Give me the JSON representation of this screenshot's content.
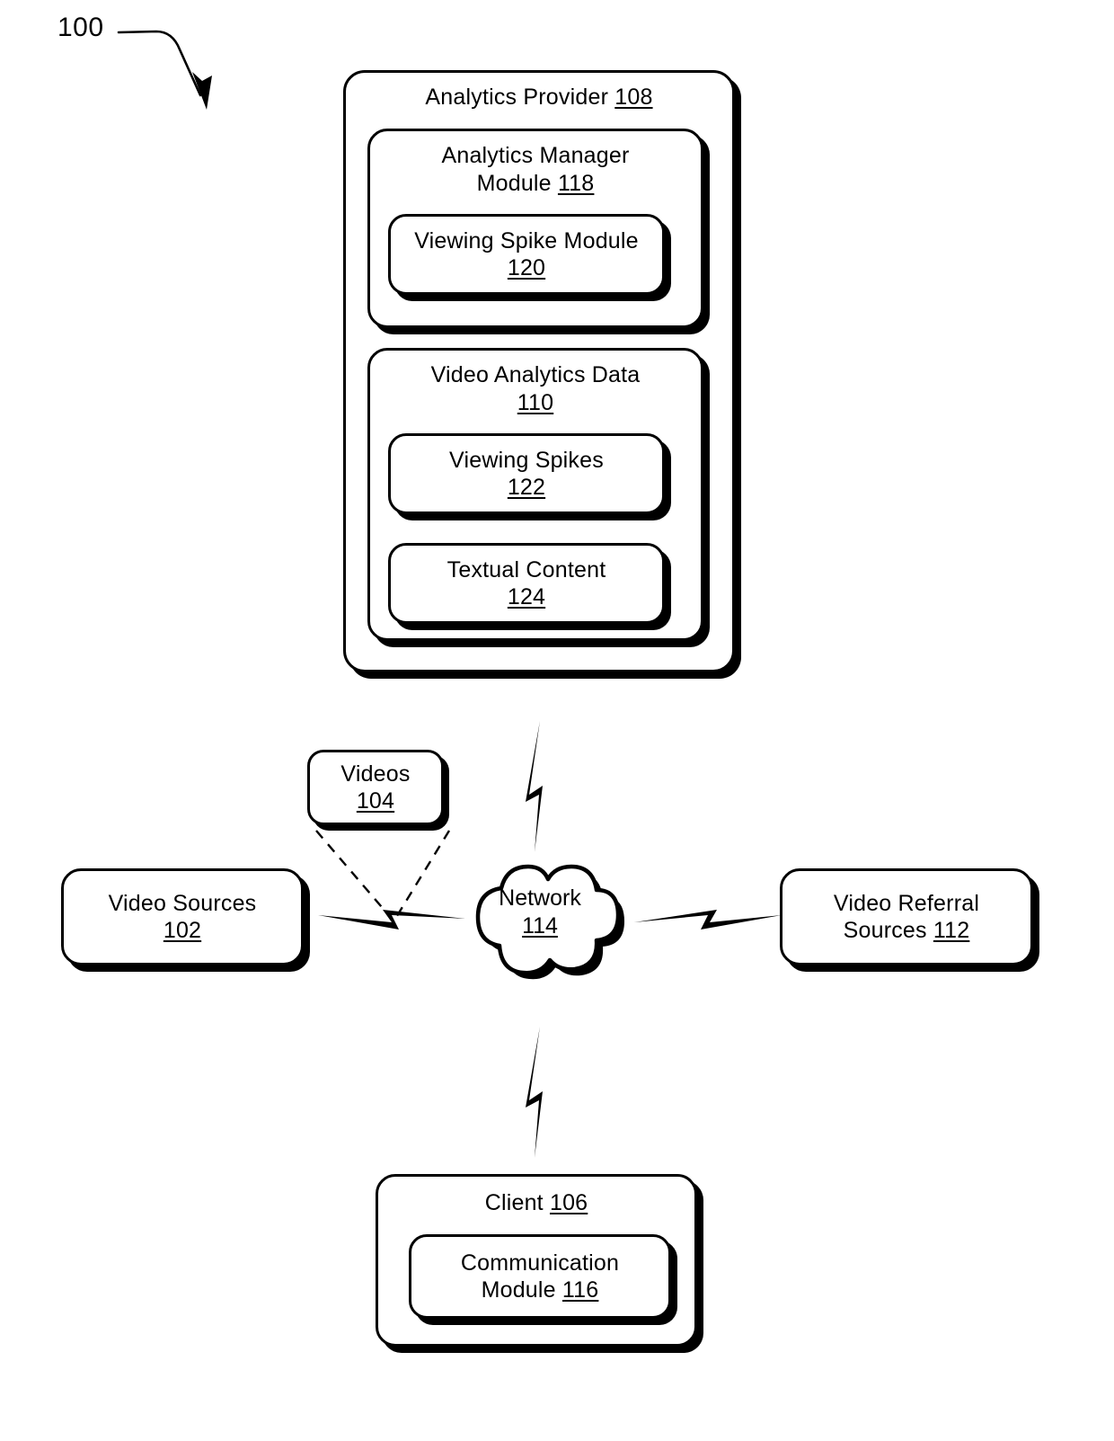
{
  "figure": {
    "number": "100",
    "arrow_icon": "curved-arrow-icon"
  },
  "nodes": {
    "analytics_provider": {
      "label": "Analytics Provider ",
      "ref": "108"
    },
    "analytics_manager_module": {
      "label": "Analytics Manager\nModule ",
      "ref": "118"
    },
    "viewing_spike_module": {
      "label": "Viewing Spike Module\n",
      "ref": "120"
    },
    "video_analytics_data": {
      "label": "Video Analytics Data\n",
      "ref": "110"
    },
    "viewing_spikes": {
      "label": "Viewing Spikes\n",
      "ref": "122"
    },
    "textual_content": {
      "label": "Textual Content\n",
      "ref": "124"
    },
    "videos": {
      "label": "Videos\n",
      "ref": "104"
    },
    "video_sources": {
      "label": "Video Sources\n",
      "ref": "102"
    },
    "video_referral_sources": {
      "label": "Video Referral\nSources ",
      "ref": "112"
    },
    "network": {
      "label": "Network\n",
      "ref": "114"
    },
    "client": {
      "label": "Client ",
      "ref": "106"
    },
    "communication_module": {
      "label": "Communication\nModule ",
      "ref": "116"
    }
  },
  "connectors": {
    "provider_to_network": "lightning-bolt-icon",
    "network_to_client": "lightning-bolt-icon",
    "video_sources_to_network": "lightning-bolt-icon",
    "network_to_video_referral_sources": "lightning-bolt-icon",
    "videos_leader_left": "dashed-leader-line",
    "videos_leader_right": "dashed-leader-line"
  },
  "style": {
    "stroke": "#000000",
    "fill": "#ffffff"
  }
}
